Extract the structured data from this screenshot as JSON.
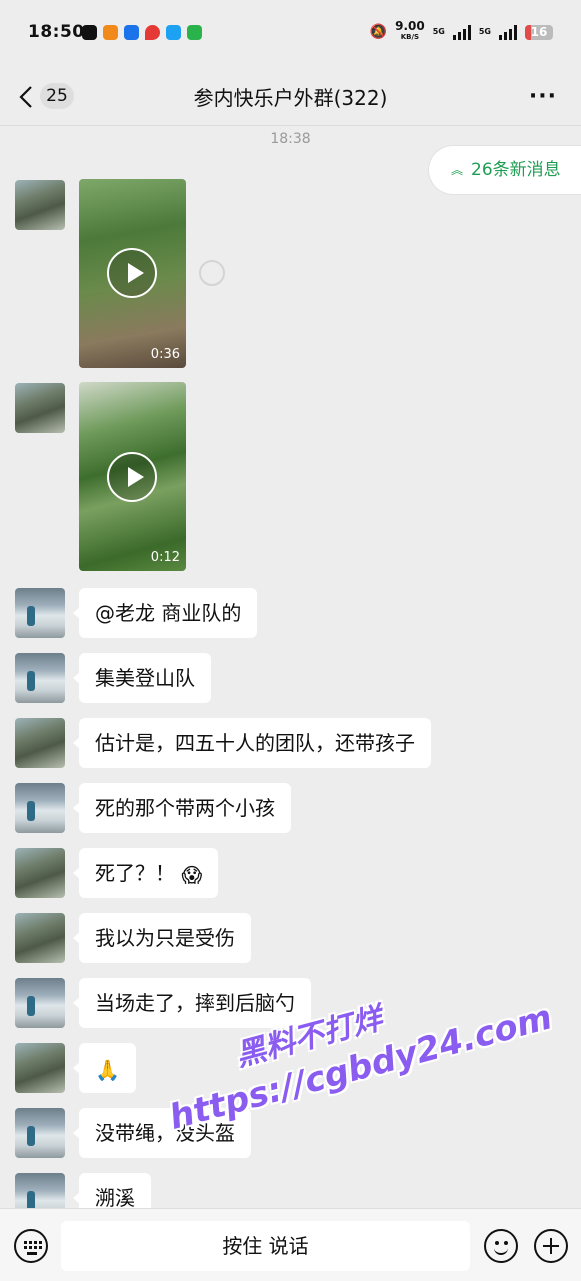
{
  "status_bar": {
    "time": "18:50",
    "speed_value": "9.00",
    "speed_unit": "KB/S",
    "network1": "5G",
    "network2": "5G",
    "battery": "16",
    "app_icons": [
      "#111111",
      "#f28a1b",
      "#1a73e8",
      "#e53935",
      "#1da1f2",
      "#2bb34b"
    ]
  },
  "header": {
    "unread_count": "25",
    "title": "参内快乐户外群(322)",
    "more": "···"
  },
  "timestamp": "18:38",
  "new_messages": {
    "arrow": "︽",
    "label": "26条新消息"
  },
  "messages": [
    {
      "type": "video",
      "duration": "0:36"
    },
    {
      "type": "video",
      "duration": "0:12"
    },
    {
      "type": "text",
      "text": "@老龙  商业队的"
    },
    {
      "type": "text",
      "text": "集美登山队"
    },
    {
      "type": "text",
      "text": "估计是，四五十人的团队，还带孩子"
    },
    {
      "type": "text",
      "text": "死的那个带两个小孩"
    },
    {
      "type": "text",
      "text": "死了？！",
      "emoji": "😱"
    },
    {
      "type": "text",
      "text": "我以为只是受伤"
    },
    {
      "type": "text",
      "text": "当场走了，摔到后脑勺"
    },
    {
      "type": "emoji",
      "emoji": "🙏"
    },
    {
      "type": "text",
      "text": "没带绳，没头盔"
    },
    {
      "type": "text",
      "text": "溯溪"
    }
  ],
  "watermark": {
    "line1": "黑料不打烊",
    "line2": "https://cgbdy24.com"
  },
  "bottom_bar": {
    "hold_to_talk": "按住 说话"
  }
}
